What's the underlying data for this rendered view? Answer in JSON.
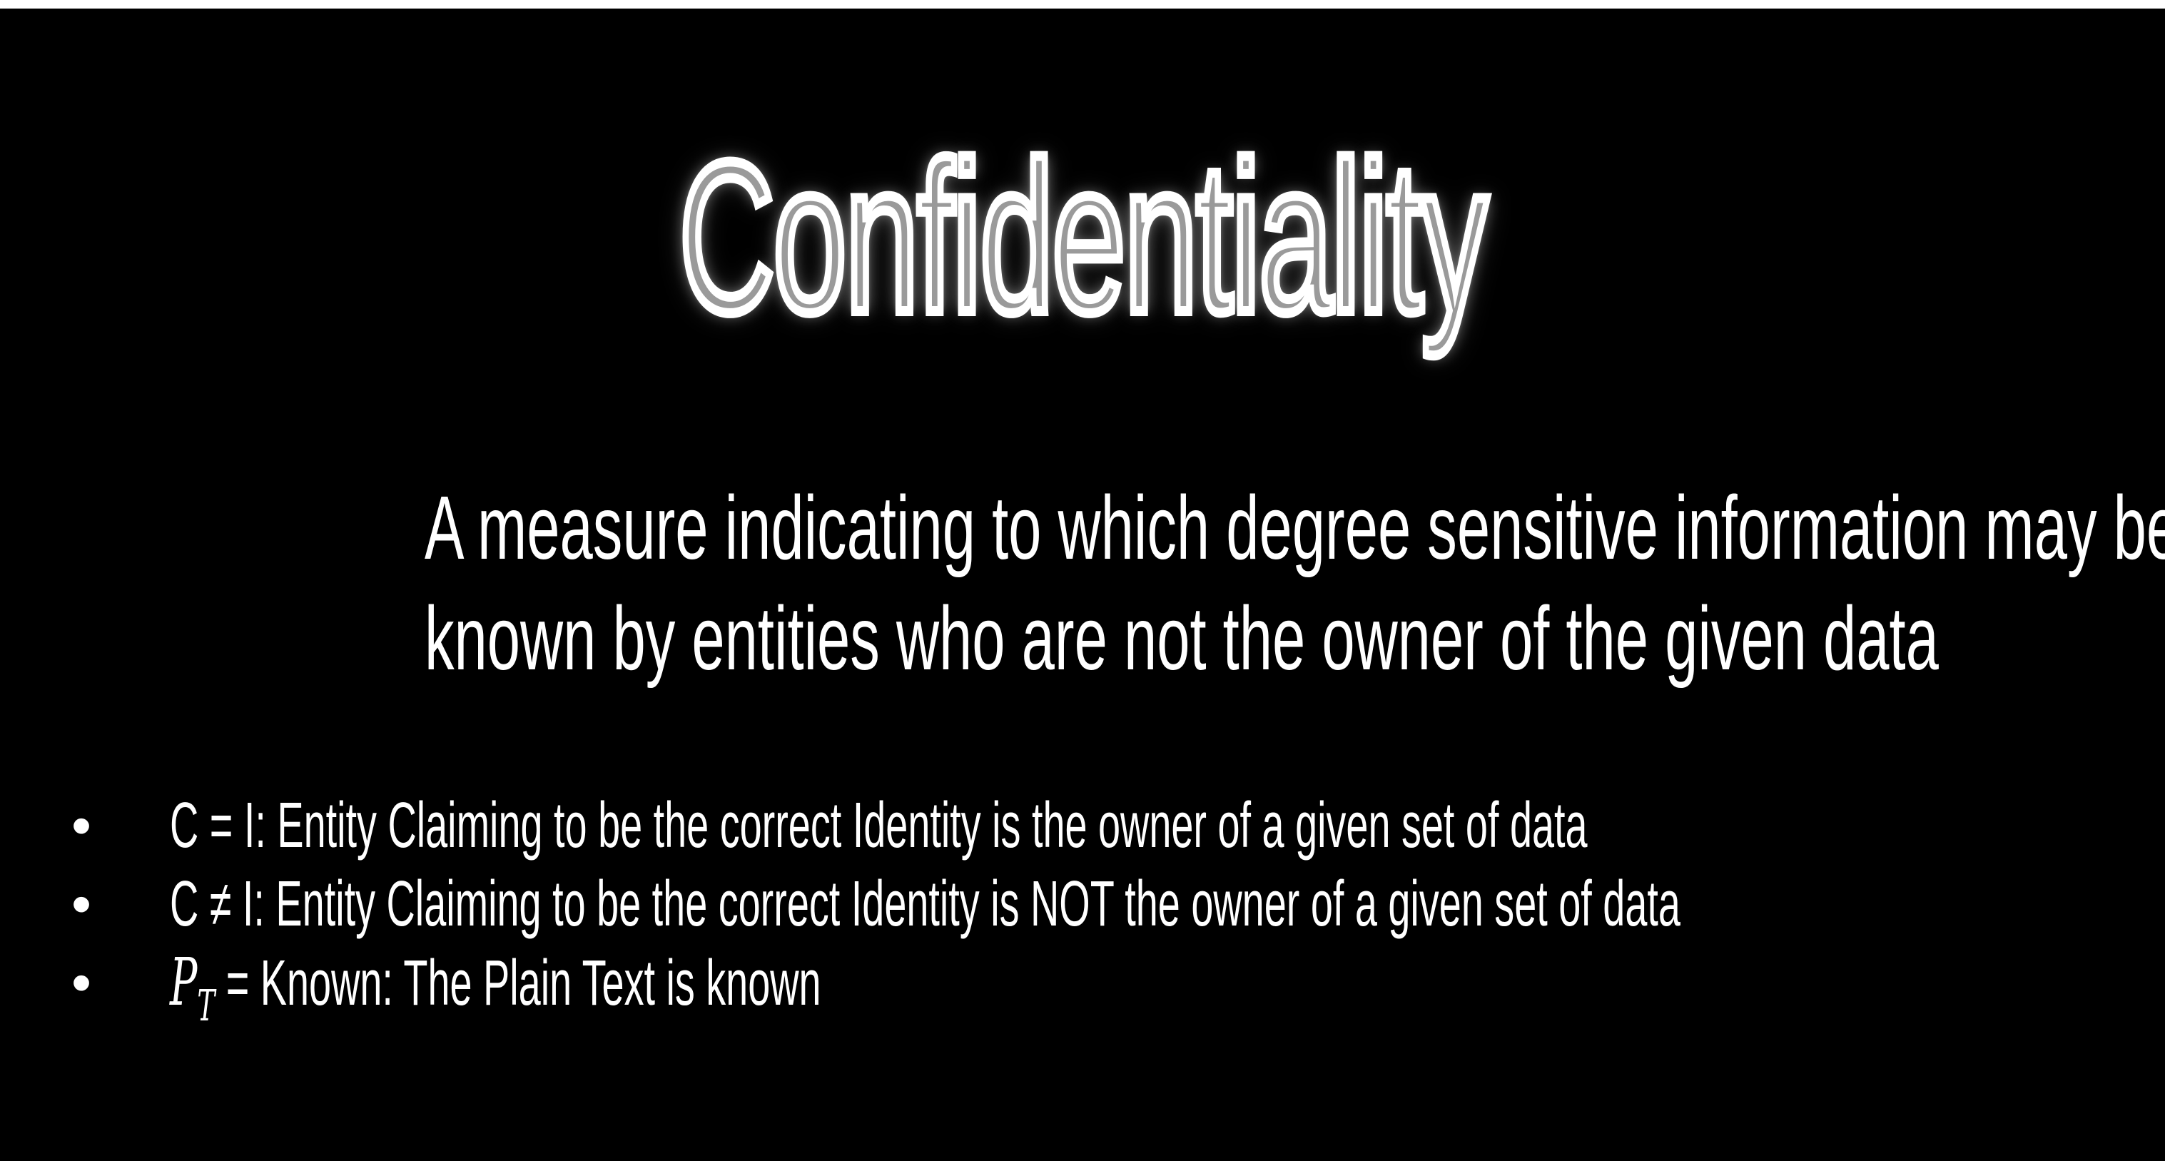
{
  "title": "Confidentiality",
  "definition": {
    "line1": "A measure indicating to which degree sensitive information may be",
    "line2": "known by entities who are not the owner of the given data"
  },
  "bullets": [
    {
      "marker": "•",
      "text": "C = I: Entity Claiming to be the correct Identity is the owner of a given set of data"
    },
    {
      "marker": "•",
      "text": "C ≠ I: Entity Claiming to be the correct Identity is NOT the owner of a given set of data"
    },
    {
      "marker": "•",
      "math_symbol": "P",
      "math_subscript": "T",
      "text": " =  Known: The Plain Text is known"
    }
  ]
}
